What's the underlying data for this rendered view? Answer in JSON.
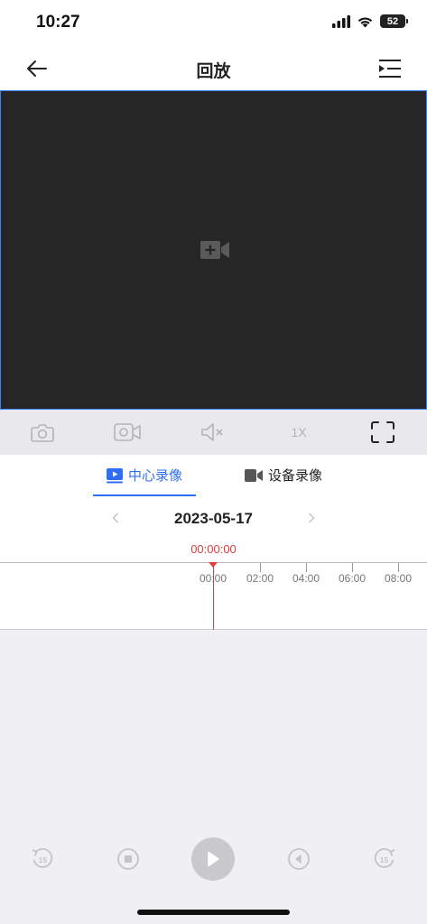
{
  "status_bar": {
    "time": "10:27",
    "battery": "52"
  },
  "nav": {
    "title": "回放"
  },
  "controls": {
    "speed": "1X"
  },
  "tabs": [
    {
      "label": "中心录像",
      "active": true
    },
    {
      "label": "设备录像",
      "active": false
    }
  ],
  "date": {
    "value": "2023-05-17"
  },
  "timeline": {
    "current_time": "00:00:00",
    "tick_labels": [
      "00:00",
      "02:00",
      "04:00",
      "06:00",
      "08:00"
    ]
  },
  "colors": {
    "accent": "#2f6df6",
    "time_marker": "#e03d3d",
    "video_bg": "#262626"
  },
  "icons": {
    "back": "arrow-left-icon",
    "menu": "list-indent-icon",
    "video_add": "video-plus-icon",
    "snapshot": "camera-icon",
    "record": "video-record-icon",
    "mute": "speaker-mute-icon",
    "fullscreen": "fullscreen-icon",
    "rewind": "rewind-15-icon",
    "stop": "stop-icon",
    "play": "play-icon",
    "prev_frame": "prev-frame-icon",
    "forward": "forward-15-icon"
  }
}
